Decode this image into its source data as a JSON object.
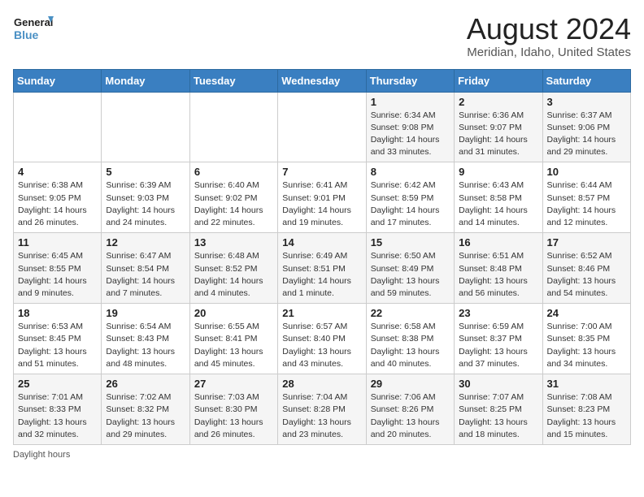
{
  "header": {
    "logo_line1": "General",
    "logo_line2": "Blue",
    "title": "August 2024",
    "subtitle": "Meridian, Idaho, United States"
  },
  "weekdays": [
    "Sunday",
    "Monday",
    "Tuesday",
    "Wednesday",
    "Thursday",
    "Friday",
    "Saturday"
  ],
  "weeks": [
    [
      {
        "day": "",
        "info": ""
      },
      {
        "day": "",
        "info": ""
      },
      {
        "day": "",
        "info": ""
      },
      {
        "day": "",
        "info": ""
      },
      {
        "day": "1",
        "info": "Sunrise: 6:34 AM\nSunset: 9:08 PM\nDaylight: 14 hours and 33 minutes."
      },
      {
        "day": "2",
        "info": "Sunrise: 6:36 AM\nSunset: 9:07 PM\nDaylight: 14 hours and 31 minutes."
      },
      {
        "day": "3",
        "info": "Sunrise: 6:37 AM\nSunset: 9:06 PM\nDaylight: 14 hours and 29 minutes."
      }
    ],
    [
      {
        "day": "4",
        "info": "Sunrise: 6:38 AM\nSunset: 9:05 PM\nDaylight: 14 hours and 26 minutes."
      },
      {
        "day": "5",
        "info": "Sunrise: 6:39 AM\nSunset: 9:03 PM\nDaylight: 14 hours and 24 minutes."
      },
      {
        "day": "6",
        "info": "Sunrise: 6:40 AM\nSunset: 9:02 PM\nDaylight: 14 hours and 22 minutes."
      },
      {
        "day": "7",
        "info": "Sunrise: 6:41 AM\nSunset: 9:01 PM\nDaylight: 14 hours and 19 minutes."
      },
      {
        "day": "8",
        "info": "Sunrise: 6:42 AM\nSunset: 8:59 PM\nDaylight: 14 hours and 17 minutes."
      },
      {
        "day": "9",
        "info": "Sunrise: 6:43 AM\nSunset: 8:58 PM\nDaylight: 14 hours and 14 minutes."
      },
      {
        "day": "10",
        "info": "Sunrise: 6:44 AM\nSunset: 8:57 PM\nDaylight: 14 hours and 12 minutes."
      }
    ],
    [
      {
        "day": "11",
        "info": "Sunrise: 6:45 AM\nSunset: 8:55 PM\nDaylight: 14 hours and 9 minutes."
      },
      {
        "day": "12",
        "info": "Sunrise: 6:47 AM\nSunset: 8:54 PM\nDaylight: 14 hours and 7 minutes."
      },
      {
        "day": "13",
        "info": "Sunrise: 6:48 AM\nSunset: 8:52 PM\nDaylight: 14 hours and 4 minutes."
      },
      {
        "day": "14",
        "info": "Sunrise: 6:49 AM\nSunset: 8:51 PM\nDaylight: 14 hours and 1 minute."
      },
      {
        "day": "15",
        "info": "Sunrise: 6:50 AM\nSunset: 8:49 PM\nDaylight: 13 hours and 59 minutes."
      },
      {
        "day": "16",
        "info": "Sunrise: 6:51 AM\nSunset: 8:48 PM\nDaylight: 13 hours and 56 minutes."
      },
      {
        "day": "17",
        "info": "Sunrise: 6:52 AM\nSunset: 8:46 PM\nDaylight: 13 hours and 54 minutes."
      }
    ],
    [
      {
        "day": "18",
        "info": "Sunrise: 6:53 AM\nSunset: 8:45 PM\nDaylight: 13 hours and 51 minutes."
      },
      {
        "day": "19",
        "info": "Sunrise: 6:54 AM\nSunset: 8:43 PM\nDaylight: 13 hours and 48 minutes."
      },
      {
        "day": "20",
        "info": "Sunrise: 6:55 AM\nSunset: 8:41 PM\nDaylight: 13 hours and 45 minutes."
      },
      {
        "day": "21",
        "info": "Sunrise: 6:57 AM\nSunset: 8:40 PM\nDaylight: 13 hours and 43 minutes."
      },
      {
        "day": "22",
        "info": "Sunrise: 6:58 AM\nSunset: 8:38 PM\nDaylight: 13 hours and 40 minutes."
      },
      {
        "day": "23",
        "info": "Sunrise: 6:59 AM\nSunset: 8:37 PM\nDaylight: 13 hours and 37 minutes."
      },
      {
        "day": "24",
        "info": "Sunrise: 7:00 AM\nSunset: 8:35 PM\nDaylight: 13 hours and 34 minutes."
      }
    ],
    [
      {
        "day": "25",
        "info": "Sunrise: 7:01 AM\nSunset: 8:33 PM\nDaylight: 13 hours and 32 minutes."
      },
      {
        "day": "26",
        "info": "Sunrise: 7:02 AM\nSunset: 8:32 PM\nDaylight: 13 hours and 29 minutes."
      },
      {
        "day": "27",
        "info": "Sunrise: 7:03 AM\nSunset: 8:30 PM\nDaylight: 13 hours and 26 minutes."
      },
      {
        "day": "28",
        "info": "Sunrise: 7:04 AM\nSunset: 8:28 PM\nDaylight: 13 hours and 23 minutes."
      },
      {
        "day": "29",
        "info": "Sunrise: 7:06 AM\nSunset: 8:26 PM\nDaylight: 13 hours and 20 minutes."
      },
      {
        "day": "30",
        "info": "Sunrise: 7:07 AM\nSunset: 8:25 PM\nDaylight: 13 hours and 18 minutes."
      },
      {
        "day": "31",
        "info": "Sunrise: 7:08 AM\nSunset: 8:23 PM\nDaylight: 13 hours and 15 minutes."
      }
    ]
  ],
  "footer": "Daylight hours"
}
